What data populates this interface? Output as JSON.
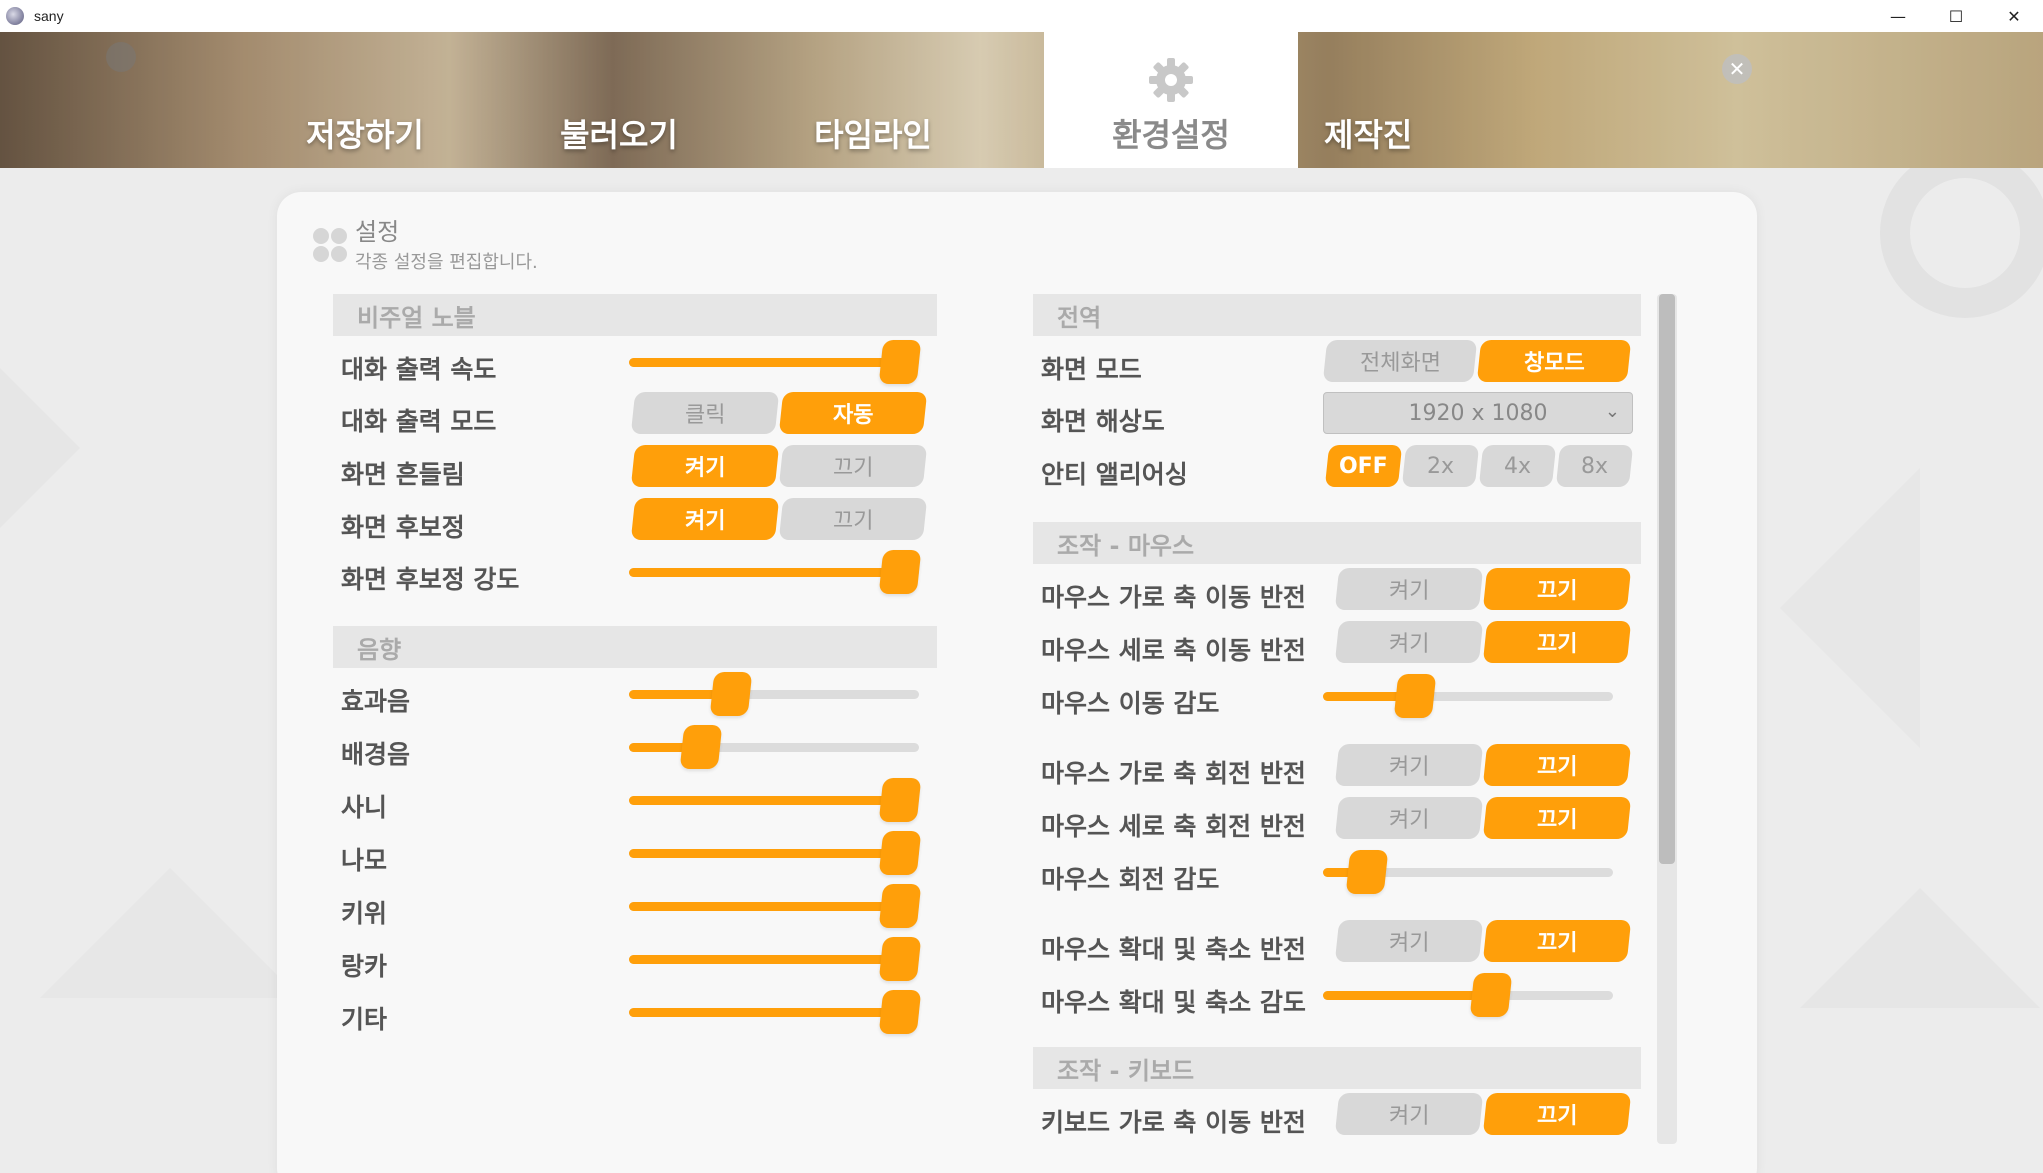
{
  "window": {
    "title": "sany",
    "minimize": "—",
    "maximize": "☐",
    "close": "✕"
  },
  "nav": {
    "tabs": [
      {
        "label": "저장하기"
      },
      {
        "label": "불러오기"
      },
      {
        "label": "타임라인"
      },
      {
        "label": "환경설정",
        "active": true
      },
      {
        "label": "제작진"
      }
    ],
    "close": "✕"
  },
  "panel": {
    "title": "설정",
    "subtitle": "각종 설정을 편집합니다."
  },
  "visual_novel": {
    "header": "비주얼 노블",
    "text_speed": {
      "label": "대화 출력 속도",
      "value": 1.0
    },
    "text_mode": {
      "label": "대화 출력 모드",
      "options": [
        "클릭",
        "자동"
      ],
      "selected": "자동"
    },
    "screen_shake": {
      "label": "화면 흔들림",
      "options": [
        "켜기",
        "끄기"
      ],
      "selected": "켜기"
    },
    "post_processing": {
      "label": "화면 후보정",
      "options": [
        "켜기",
        "끄기"
      ],
      "selected": "켜기"
    },
    "post_strength": {
      "label": "화면 후보정 강도",
      "value": 1.0
    }
  },
  "audio": {
    "header": "음향",
    "items": [
      {
        "label": "효과음",
        "value": 0.33
      },
      {
        "label": "배경음",
        "value": 0.21
      },
      {
        "label": "사니",
        "value": 1.0
      },
      {
        "label": "나모",
        "value": 1.0
      },
      {
        "label": "키위",
        "value": 1.0
      },
      {
        "label": "랑카",
        "value": 1.0
      },
      {
        "label": "기타",
        "value": 1.0
      }
    ]
  },
  "global": {
    "header": "전역",
    "screen_mode": {
      "label": "화면 모드",
      "options": [
        "전체화면",
        "창모드"
      ],
      "selected": "창모드"
    },
    "resolution": {
      "label": "화면 해상도",
      "value": "1920 x 1080",
      "chevron": "⌄"
    },
    "antialias": {
      "label": "안티 앨리어싱",
      "options": [
        "OFF",
        "2x",
        "4x",
        "8x"
      ],
      "selected": "OFF"
    }
  },
  "mouse": {
    "header": "조작 - 마우스",
    "items": [
      {
        "label": "마우스 가로 축 이동 반전",
        "type": "toggle",
        "options": [
          "켜기",
          "끄기"
        ],
        "selected": "끄기"
      },
      {
        "label": "마우스 세로 축 이동 반전",
        "type": "toggle",
        "options": [
          "켜기",
          "끄기"
        ],
        "selected": "끄기"
      },
      {
        "label": "마우스 이동 감도",
        "type": "slider",
        "value": 0.29
      },
      {
        "label": "마우스 가로 축 회전 반전",
        "type": "toggle",
        "options": [
          "켜기",
          "끄기"
        ],
        "selected": "끄기"
      },
      {
        "label": "마우스 세로 축 회전 반전",
        "type": "toggle",
        "options": [
          "켜기",
          "끄기"
        ],
        "selected": "끄기"
      },
      {
        "label": "마우스 회전 감도",
        "type": "slider",
        "value": 0.1
      },
      {
        "label": "마우스 확대 및 축소 반전",
        "type": "toggle",
        "options": [
          "켜기",
          "끄기"
        ],
        "selected": "끄기"
      },
      {
        "label": "마우스 확대 및 축소 감도",
        "type": "slider",
        "value": 0.59
      }
    ]
  },
  "keyboard": {
    "header": "조작 - 키보드",
    "items": [
      {
        "label": "키보드 가로 축 이동 반전",
        "type": "toggle",
        "options": [
          "켜기",
          "끄기"
        ],
        "selected": "끄기"
      }
    ]
  },
  "colors": {
    "accent": "#ff9f0a",
    "off": "#d8d8d8",
    "header_bg": "#e6e6e6"
  }
}
